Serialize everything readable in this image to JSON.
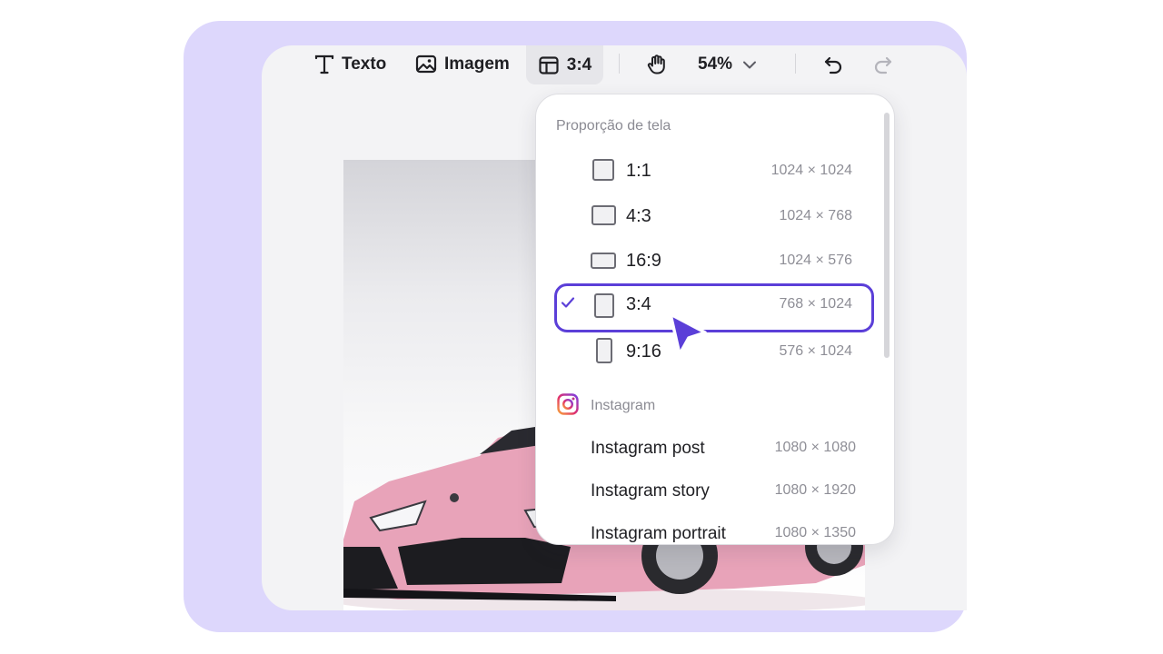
{
  "toolbar": {
    "text_label": "Texto",
    "image_label": "Imagem",
    "ratio_label": "3:4",
    "zoom_label": "54%"
  },
  "dropdown": {
    "section_title": "Proporção de tela",
    "ratios": [
      {
        "label": "1:1",
        "dims": "1024 × 1024",
        "selected": false
      },
      {
        "label": "4:3",
        "dims": "1024 × 768",
        "selected": false
      },
      {
        "label": "16:9",
        "dims": "1024 × 576",
        "selected": false
      },
      {
        "label": "3:4",
        "dims": "768 × 1024",
        "selected": true
      },
      {
        "label": "9:16",
        "dims": "576 × 1024",
        "selected": false
      }
    ],
    "instagram": {
      "title": "Instagram",
      "items": [
        {
          "label": "Instagram post",
          "dims": "1080 × 1080"
        },
        {
          "label": "Instagram story",
          "dims": "1080 × 1920"
        },
        {
          "label": "Instagram portrait",
          "dims": "1080 × 1350"
        }
      ]
    }
  },
  "colors": {
    "accent": "#5b3fd8",
    "backdrop": "#ddd7fc",
    "car_body": "#e8a3b9"
  },
  "icons": [
    "text-icon",
    "image-icon",
    "layout-icon",
    "hand-icon",
    "chevron-down-icon",
    "undo-icon",
    "redo-icon",
    "check-icon",
    "instagram-icon",
    "cursor-pointer-icon"
  ]
}
